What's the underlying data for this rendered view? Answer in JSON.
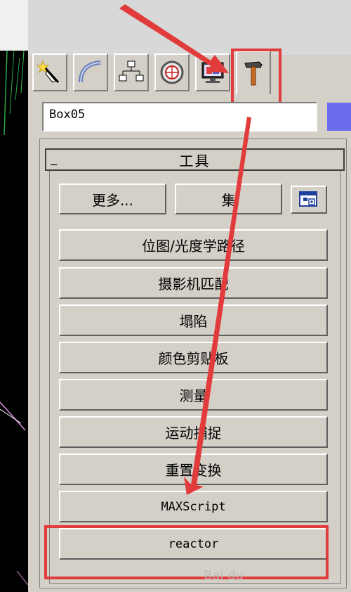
{
  "object_name": "Box05",
  "tabs": [
    {
      "name": "create-tab",
      "icon": "magic-wand-icon"
    },
    {
      "name": "modify-tab",
      "icon": "bend-curve-icon"
    },
    {
      "name": "hierarchy-tab",
      "icon": "hierarchy-icon"
    },
    {
      "name": "motion-tab",
      "icon": "wheel-icon"
    },
    {
      "name": "display-tab",
      "icon": "monitor-icon"
    },
    {
      "name": "utilities-tab",
      "icon": "hammer-icon",
      "active": true
    }
  ],
  "rollout": {
    "collapse_symbol": "_",
    "title": "工具"
  },
  "toolbar": {
    "more_label": "更多...",
    "sets_label": "集",
    "config_icon": "configure-sets-icon"
  },
  "utilities": [
    "位图/光度学路径",
    "摄影机匹配",
    "塌陷",
    "颜色剪贴板",
    "测量",
    "运动捕捉",
    "重置变换",
    "MAXScript",
    "reactor"
  ],
  "watermark": "Bai du",
  "colors": {
    "annotation_red": "#e23b3b",
    "object_color": "#6a6cf0",
    "panel_bg": "#d4d0c8"
  }
}
